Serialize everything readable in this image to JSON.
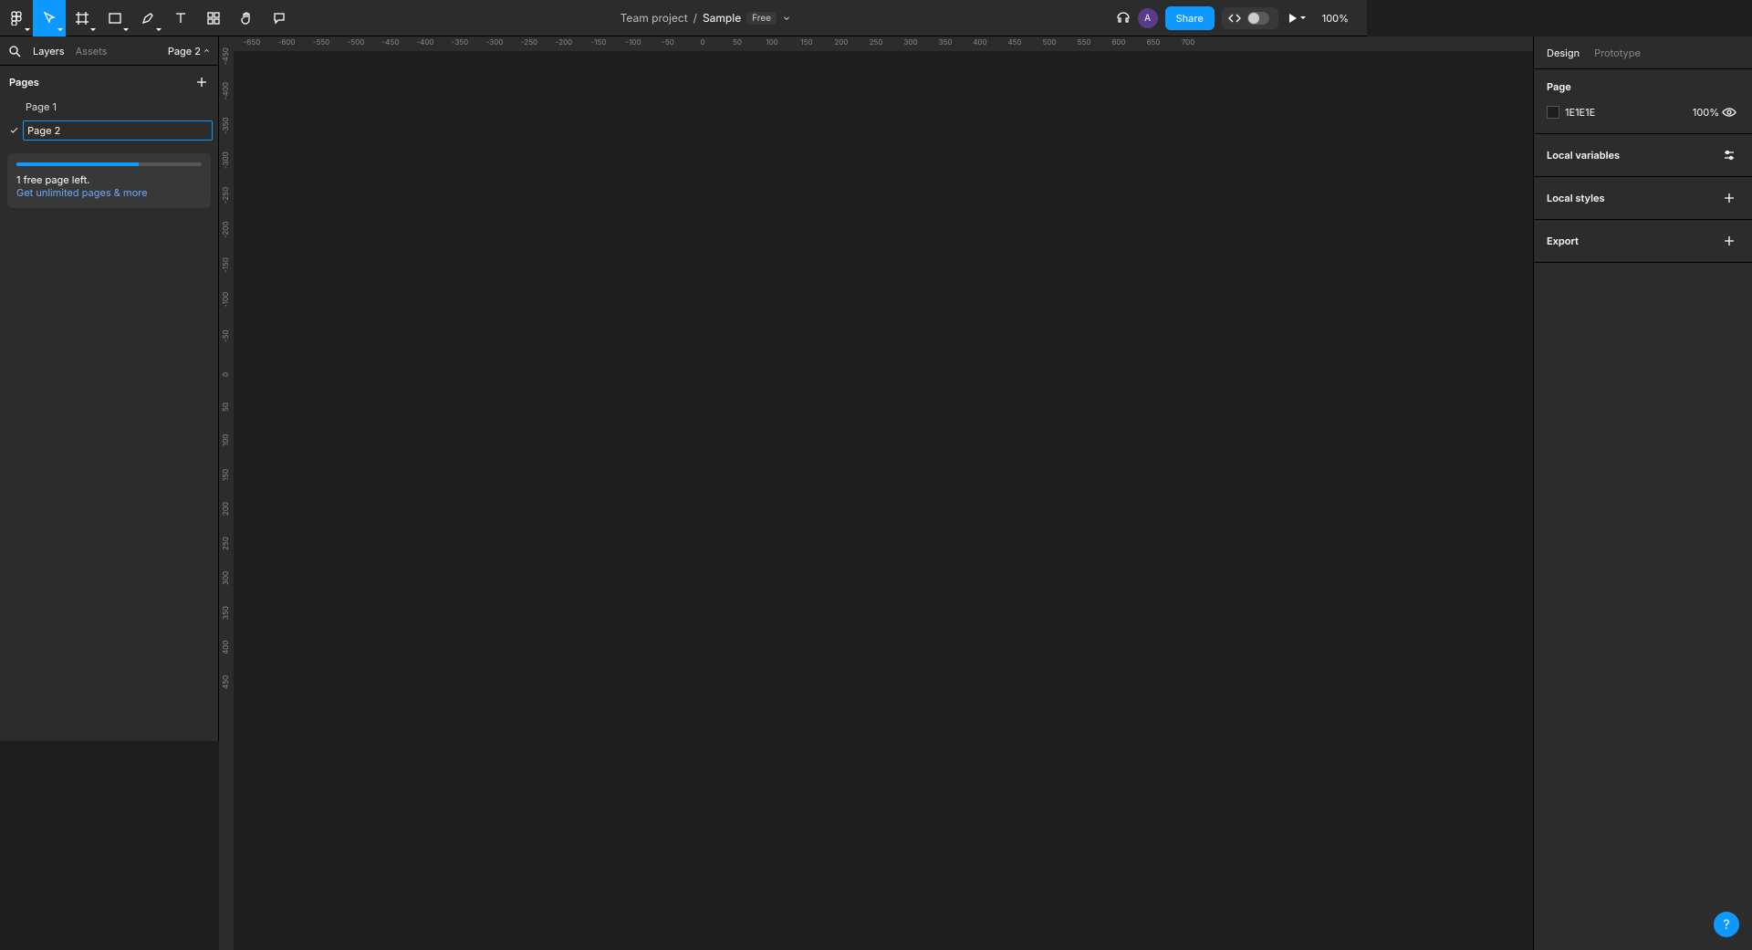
{
  "toolbar": {
    "zoom": "100%"
  },
  "title": {
    "team": "Team project",
    "separator": "/",
    "file": "Sample",
    "plan_badge": "Free"
  },
  "actions": {
    "share_label": "Share",
    "avatar_initial": "A"
  },
  "left": {
    "tabs": {
      "layers": "Layers",
      "assets": "Assets"
    },
    "page_indicator": "Page 2",
    "pages_header": "Pages",
    "pages": {
      "p1": "Page 1",
      "p2_edit_value": "Page 2"
    },
    "quota": {
      "line1": "1 free page left.",
      "line2_link": "Get unlimited pages & more"
    }
  },
  "right": {
    "tabs": {
      "design": "Design",
      "prototype": "Prototype"
    },
    "page_section": "Page",
    "bg_hex": "1E1E1E",
    "bg_opacity": "100%",
    "local_variables": "Local variables",
    "local_styles": "Local styles",
    "export": "Export"
  },
  "ruler": {
    "h": [
      "-650",
      "-600",
      "-550",
      "-500",
      "-450",
      "-400",
      "-350",
      "-300",
      "-250",
      "-200",
      "-150",
      "-100",
      "-50",
      "0",
      "50",
      "100",
      "150",
      "200",
      "250",
      "300",
      "350",
      "400",
      "450",
      "500",
      "550",
      "600",
      "650",
      "700"
    ],
    "v": [
      "-450",
      "-400",
      "-350",
      "-300",
      "-250",
      "-200",
      "-150",
      "-100",
      "-50",
      "0",
      "50",
      "100",
      "150",
      "200",
      "250",
      "300",
      "350",
      "400",
      "450"
    ]
  },
  "help": "?"
}
